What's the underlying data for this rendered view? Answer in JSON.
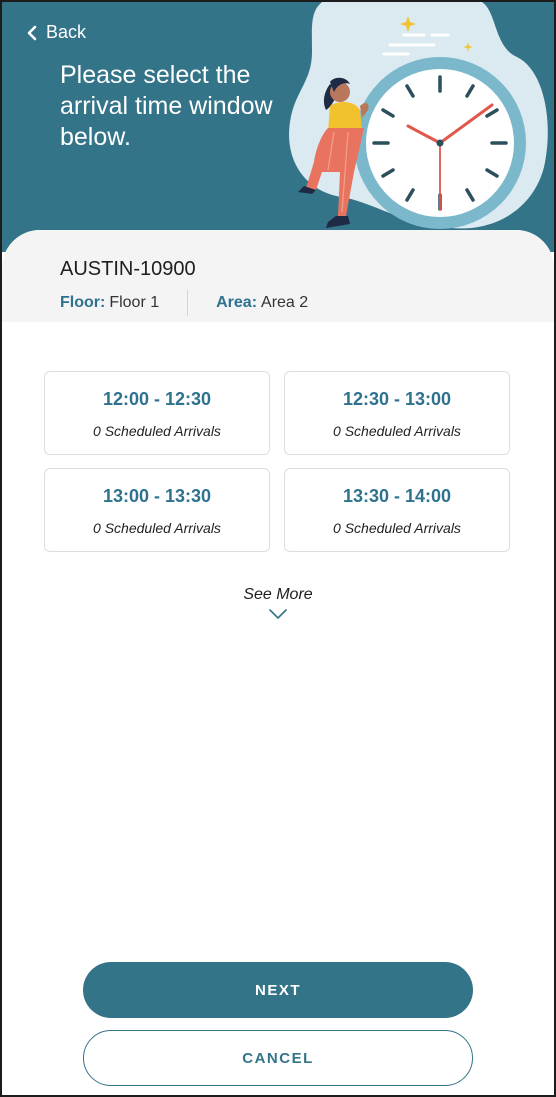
{
  "header": {
    "back_label": "Back",
    "headline": "Please select the arrival time window below."
  },
  "location": {
    "name": "AUSTIN-10900",
    "floor_label": "Floor:",
    "floor_value": "Floor 1",
    "area_label": "Area:",
    "area_value": "Area 2"
  },
  "slots": [
    {
      "time": "12:00 - 12:30",
      "count": "0 Scheduled Arrivals"
    },
    {
      "time": "12:30 - 13:00",
      "count": "0 Scheduled Arrivals"
    },
    {
      "time": "13:00 - 13:30",
      "count": "0 Scheduled Arrivals"
    },
    {
      "time": "13:30 - 14:00",
      "count": "0 Scheduled Arrivals"
    }
  ],
  "see_more_label": "See More",
  "buttons": {
    "next_label": "NEXT",
    "cancel_label": "CANCEL"
  },
  "colors": {
    "primary": "#347488",
    "accent_text": "#2e7290",
    "clock_hand": "#e2574c",
    "figure_shirt": "#f2c12e",
    "figure_pants": "#e8735f"
  },
  "icons": {
    "back": "chevron-left-icon",
    "see_more": "chevron-down-icon"
  }
}
